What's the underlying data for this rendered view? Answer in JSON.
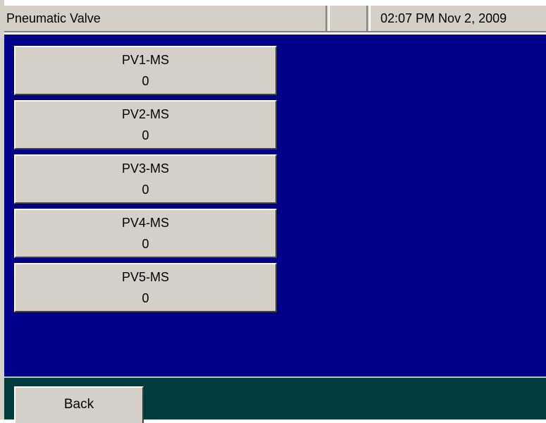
{
  "header": {
    "title": "Pneumatic Valve",
    "blank": "",
    "clock": "02:07 PM Nov 2, 2009"
  },
  "valves": [
    {
      "name": "PV1-MS",
      "value": "0"
    },
    {
      "name": "PV2-MS",
      "value": "0"
    },
    {
      "name": "PV3-MS",
      "value": "0"
    },
    {
      "name": "PV4-MS",
      "value": "0"
    },
    {
      "name": "PV5-MS",
      "value": "0"
    }
  ],
  "footer": {
    "back_label": "Back"
  },
  "colors": {
    "panel_background": "#00008b",
    "footer_background": "#003c3c",
    "button_face": "#d4d0c8"
  }
}
